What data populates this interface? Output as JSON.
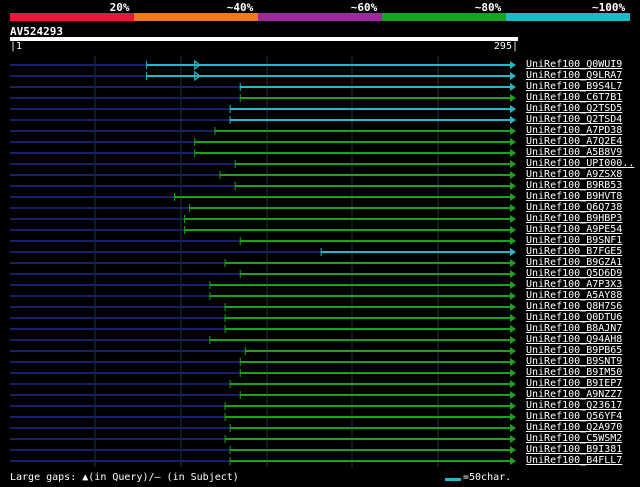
{
  "legend": [
    {
      "label": "20%",
      "color": "#e6173a"
    },
    {
      "label": "~40%",
      "color": "#ee7a1d"
    },
    {
      "label": "~60%",
      "color": "#9a2aa0"
    },
    {
      "label": "~80%",
      "color": "#1aa21a"
    },
    {
      "label": "~100%",
      "color": "#22b8c8"
    }
  ],
  "query": {
    "name": "AV524293",
    "start": "1",
    "end": "295"
  },
  "colors": {
    "green": "#1aa21a",
    "cyan": "#22b8c8",
    "navy": "#16206a",
    "grid": "#223344"
  },
  "hits": [
    {
      "label": "UniRef100_Q0WUI9",
      "start": 0.27,
      "color": "cyan",
      "arrow": 0.375
    },
    {
      "label": "UniRef100_Q9LRA7",
      "start": 0.27,
      "color": "cyan",
      "arrow": 0.375
    },
    {
      "label": "UniRef100_B9S4L7",
      "start": 0.455,
      "color": "cyan"
    },
    {
      "label": "UniRef100_C6T7B1",
      "start": 0.455,
      "color": "green"
    },
    {
      "label": "UniRef100_Q2TSD5",
      "start": 0.435,
      "color": "cyan"
    },
    {
      "label": "UniRef100_Q2TSD4",
      "start": 0.435,
      "color": "cyan"
    },
    {
      "label": "UniRef100_A7PD38",
      "start": 0.405,
      "color": "green"
    },
    {
      "label": "UniRef100_A7Q2E4",
      "start": 0.365,
      "color": "green"
    },
    {
      "label": "UniRef100_A5B8V9",
      "start": 0.365,
      "color": "green"
    },
    {
      "label": "UniRef100_UPI000..",
      "start": 0.445,
      "color": "green"
    },
    {
      "label": "UniRef100_A9ZSX8",
      "start": 0.415,
      "color": "green"
    },
    {
      "label": "UniRef100_B9RB53",
      "start": 0.445,
      "color": "green"
    },
    {
      "label": "UniRef100_B9HVT8",
      "start": 0.325,
      "color": "green"
    },
    {
      "label": "UniRef100_Q6Q738",
      "start": 0.355,
      "color": "green"
    },
    {
      "label": "UniRef100_B9HBP3",
      "start": 0.345,
      "color": "green"
    },
    {
      "label": "UniRef100_A9PE54",
      "start": 0.345,
      "color": "green"
    },
    {
      "label": "UniRef100_B9SNF1",
      "start": 0.455,
      "color": "green"
    },
    {
      "label": "UniRef100_B7FGE5",
      "start": 0.615,
      "color": "cyan"
    },
    {
      "label": "UniRef100_B9GZA1",
      "start": 0.425,
      "color": "green"
    },
    {
      "label": "UniRef100_Q5D6D9",
      "start": 0.455,
      "color": "green"
    },
    {
      "label": "UniRef100_A7P3X3",
      "start": 0.395,
      "color": "green"
    },
    {
      "label": "UniRef100_A5AY88",
      "start": 0.395,
      "color": "green"
    },
    {
      "label": "UniRef100_Q8H7S6",
      "start": 0.425,
      "color": "green"
    },
    {
      "label": "UniRef100_Q0DTU6",
      "start": 0.425,
      "color": "green"
    },
    {
      "label": "UniRef100_B8AJN7",
      "start": 0.425,
      "color": "green"
    },
    {
      "label": "UniRef100_Q94AH8",
      "start": 0.395,
      "color": "green"
    },
    {
      "label": "UniRef100_B9PB65",
      "start": 0.465,
      "color": "green"
    },
    {
      "label": "UniRef100_B9SNT9",
      "start": 0.455,
      "color": "green"
    },
    {
      "label": "UniRef100_B9IM50",
      "start": 0.455,
      "color": "green"
    },
    {
      "label": "UniRef100_B9IEP7",
      "start": 0.435,
      "color": "green"
    },
    {
      "label": "UniRef100_A9NZZ7",
      "start": 0.455,
      "color": "green"
    },
    {
      "label": "UniRef100_Q23617",
      "start": 0.425,
      "color": "green"
    },
    {
      "label": "UniRef100_Q56YF4",
      "start": 0.425,
      "color": "green"
    },
    {
      "label": "UniRef100_Q2A970",
      "start": 0.435,
      "color": "green"
    },
    {
      "label": "UniRef100_C5WSM2",
      "start": 0.425,
      "color": "green"
    },
    {
      "label": "UniRef100_B9I381",
      "start": 0.435,
      "color": "green"
    },
    {
      "label": "UniRef100_B4FLL7",
      "start": 0.435,
      "color": "green"
    }
  ],
  "footer": {
    "gaps_label": "Large gaps: ",
    "gap_query_marker": "▲",
    "gaps_rest": "(in Query)/– (in Subject)",
    "scale_label": "=50char."
  }
}
